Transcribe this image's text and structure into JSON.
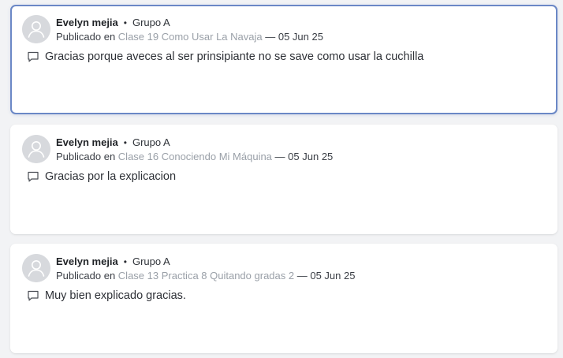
{
  "comments": [
    {
      "author": "Evelyn mejia",
      "separator": "•",
      "group": "Grupo A",
      "published_prefix": "Publicado en",
      "lesson": "Clase 19 Como Usar La Navaja",
      "date_separator": "—",
      "date": "05 Jun 25",
      "text": "Gracias porque aveces al ser prinsipiante no se save como usar la cuchilla",
      "selected": true
    },
    {
      "author": "Evelyn mejia",
      "separator": "•",
      "group": "Grupo A",
      "published_prefix": "Publicado en",
      "lesson": "Clase 16 Conociendo Mi Máquina",
      "date_separator": "—",
      "date": "05 Jun 25",
      "text": "Gracias por la explicacion",
      "selected": false
    },
    {
      "author": "Evelyn mejia",
      "separator": "•",
      "group": "Grupo A",
      "published_prefix": "Publicado en",
      "lesson": "Clase 13 Practica 8 Quitando gradas 2",
      "date_separator": "—",
      "date": "05 Jun 25",
      "text": "Muy bien explicado gracias.",
      "selected": false
    }
  ],
  "icons": {
    "avatar": "user-placeholder-icon",
    "comment": "speech-bubble-icon"
  },
  "colors": {
    "selected_border": "#6b88c6",
    "lesson_link": "#9aa0a8",
    "avatar_bg": "#d7d9dd"
  }
}
